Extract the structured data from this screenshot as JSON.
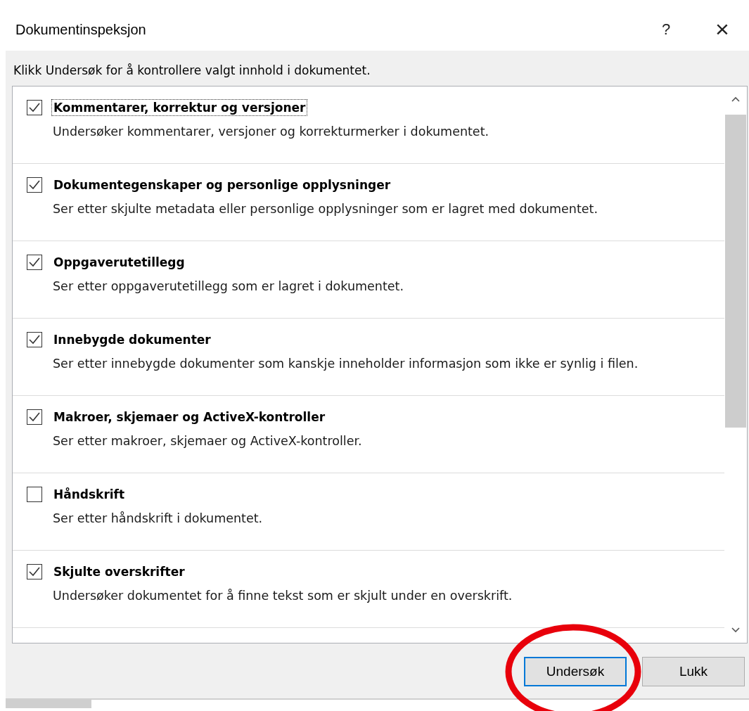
{
  "window": {
    "title": "Dokumentinspeksjon",
    "help": "?",
    "close": "×"
  },
  "instruction": "Klikk Undersøk for å kontrollere valgt innhold i dokumentet.",
  "items": [
    {
      "title": "Kommentarer, korrektur og versjoner",
      "description": "Undersøker kommentarer, versjoner og korrekturmerker i dokumentet.",
      "checked": true,
      "focused": true
    },
    {
      "title": "Dokumentegenskaper og personlige opplysninger",
      "description": "Ser etter skjulte metadata eller personlige opplysninger som er lagret med dokumentet.",
      "checked": true,
      "focused": false
    },
    {
      "title": "Oppgaverutetillegg",
      "description": "Ser etter oppgaverutetillegg som er lagret i dokumentet.",
      "checked": true,
      "focused": false
    },
    {
      "title": "Innebygde dokumenter",
      "description": "Ser etter innebygde dokumenter som kanskje inneholder informasjon som ikke er synlig i filen.",
      "checked": true,
      "focused": false
    },
    {
      "title": "Makroer, skjemaer og ActiveX-kontroller",
      "description": "Ser etter makroer, skjemaer og ActiveX-kontroller.",
      "checked": true,
      "focused": false
    },
    {
      "title": "Håndskrift",
      "description": "Ser etter håndskrift i dokumentet.",
      "checked": false,
      "focused": false
    },
    {
      "title": "Skjulte overskrifter",
      "description": "Undersøker dokumentet for å finne tekst som er skjult under en overskrift.",
      "checked": true,
      "focused": false
    }
  ],
  "buttons": [
    {
      "label": "Undersøk",
      "default": true,
      "circled": true
    },
    {
      "label": "Lukk",
      "default": false,
      "circled": false
    }
  ]
}
